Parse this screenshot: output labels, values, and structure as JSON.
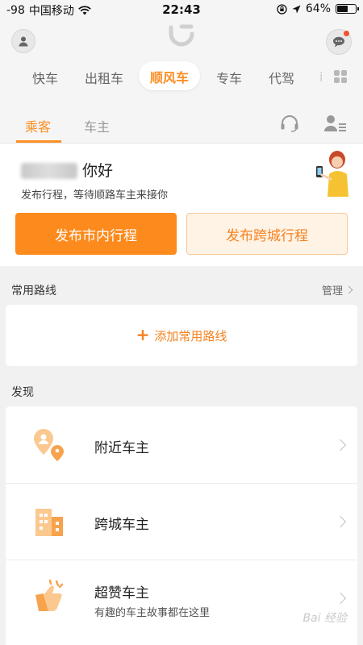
{
  "status_bar": {
    "signal": "-98",
    "carrier": "中国移动",
    "time": "22:43",
    "battery": "64%",
    "battery_level": 0.64
  },
  "header": {
    "service_tabs": [
      "快车",
      "出租车",
      "顺风车",
      "专车",
      "代驾"
    ],
    "active_service": "顺风车",
    "overflow_tab": "i"
  },
  "role_tabs": {
    "passenger": "乘客",
    "driver": "车主"
  },
  "greeting": {
    "hello": "你好",
    "subtitle": "发布行程，等待顺路车主来接你",
    "primary_button": "发布市内行程",
    "secondary_button": "发布跨城行程"
  },
  "routes": {
    "title": "常用路线",
    "manage": "管理",
    "add_label": "添加常用路线"
  },
  "discover": {
    "title": "发现",
    "items": [
      {
        "title": "附近车主"
      },
      {
        "title": "跨城车主"
      },
      {
        "title": "超赞车主",
        "subtitle": "有趣的车主故事都在这里"
      }
    ]
  },
  "watermark": "Bai 经验",
  "colors": {
    "accent": "#fc8a1c",
    "accent_light": "#fff3e6",
    "background": "#f1f1f1"
  },
  "icons": [
    "user-icon",
    "didi-logo-icon",
    "message-icon",
    "grid-icon",
    "headset-icon",
    "driver-profile-icon",
    "plus-icon",
    "location-pin-icon",
    "buildings-icon",
    "thumbs-up-icon",
    "chevron-right-icon",
    "wifi-icon",
    "location-arrow-icon",
    "lock-rotation-icon"
  ]
}
